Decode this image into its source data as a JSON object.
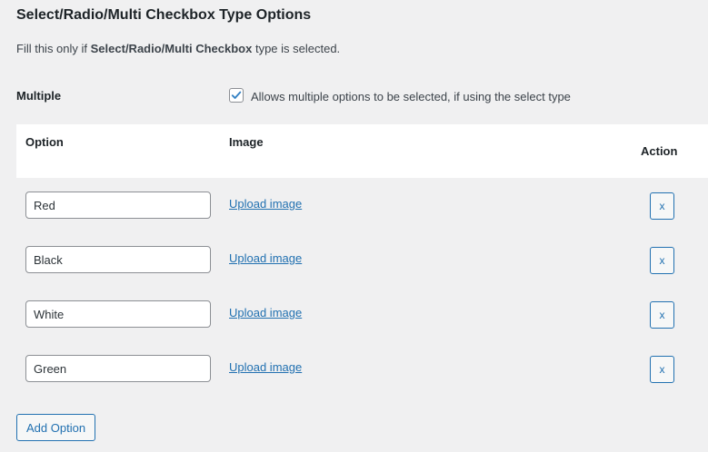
{
  "section": {
    "title": "Select/Radio/Multi Checkbox Type Options",
    "description_prefix": "Fill this only if ",
    "description_bold": "Select/Radio/Multi Checkbox",
    "description_suffix": " type is selected."
  },
  "multiple": {
    "label": "Multiple",
    "checked": true,
    "description": "Allows multiple options to be selected, if using the select type"
  },
  "table": {
    "headers": {
      "option": "Option",
      "image": "Image",
      "action": "Action"
    },
    "rows": [
      {
        "value": "Red",
        "image_link": "Upload image",
        "remove_label": "x"
      },
      {
        "value": "Black",
        "image_link": "Upload image",
        "remove_label": "x"
      },
      {
        "value": "White",
        "image_link": "Upload image",
        "remove_label": "x"
      },
      {
        "value": "Green",
        "image_link": "Upload image",
        "remove_label": "x"
      }
    ]
  },
  "add_option_label": "Add Option",
  "colors": {
    "accent": "#2271b1",
    "background": "#f0f0f1",
    "checkmark": "#3582c4"
  }
}
